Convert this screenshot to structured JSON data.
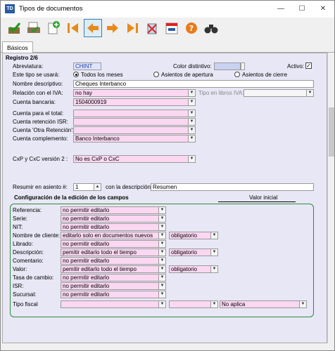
{
  "window": {
    "title": "Tipos de documentos",
    "app_icon": "TD"
  },
  "tabs": [
    "Básicos"
  ],
  "record": "Registro 2/6",
  "fields": {
    "abbrev_label": "Abreviatura:",
    "abbrev_value": "CHINT",
    "color_label": "Color distintivo:",
    "active_label": "Activo:",
    "active_checked": true,
    "usage_label": "Este tipo se usará:",
    "usage_options": [
      "Todos los meses",
      "Asientos de apertura",
      "Asientos de cierre"
    ],
    "name_label": "Nombre descriptivo:",
    "name_value": "Cheques Interbanco",
    "iva_label": "Relación con el IVA:",
    "iva_value": "no hay",
    "iva_book_label": "Tipo en libros IVA:",
    "iva_book_value": "",
    "bank_label": "Cuenta bancaria:",
    "bank_value": "1504000919",
    "total_label": "Cuenta para el total:",
    "total_value": "",
    "isr_label": "Cuenta retención ISR:",
    "isr_value": "",
    "other_label": "Cuenta 'Otra Retención':",
    "other_value": "",
    "compl_label": "Cuenta complemento:",
    "compl_value": "Banco Interbanco",
    "cxp_label": "CxP y CxC versión 2 :",
    "cxp_value": "No es CxP o CxC",
    "summ_label": "Resumir en asiento #:",
    "summ_value": "1",
    "summ_desc_label": "con la descripción",
    "summ_desc_value": "Resumen"
  },
  "config": {
    "title": "Configuración de la edición de los campos",
    "initial_header": "Valor inicial",
    "rows": [
      {
        "label": "Referencia:",
        "value": "no permitir editarlo"
      },
      {
        "label": "Serie:",
        "value": "no permitir editarlo"
      },
      {
        "label": "NIT:",
        "value": "no permitir editarlo"
      },
      {
        "label": "Nombre de cliente:",
        "value": "editarlo solo en documentos nuevos",
        "extra": "obligatorio"
      },
      {
        "label": "Librado:",
        "value": "no permitir editarlo"
      },
      {
        "label": "Descripción:",
        "value": "pemitir editarlo todo el tiempo",
        "extra": "obligatorio"
      },
      {
        "label": "Comentario:",
        "value": "no permitir editarlo"
      },
      {
        "label": "Valor:",
        "value": "pemitir editarlo todo el tiempo",
        "extra": "obligatorio"
      },
      {
        "label": "Tasa de cambio:",
        "value": "no permitir editarlo"
      },
      {
        "label": "ISR:",
        "value": "no permitir editarlo"
      },
      {
        "label": "Sucursal:",
        "value": "no permitir editarlo"
      },
      {
        "label": "Tipo fiscal",
        "value": "",
        "extra": "",
        "initial": "No aplica"
      }
    ]
  },
  "toolbar_icons": [
    "accept-icon",
    "print-icon",
    "new-icon",
    "first-icon",
    "prev-icon",
    "next-icon",
    "last-icon",
    "delete-icon",
    "calendar-icon",
    "help-icon",
    "search-icon"
  ]
}
